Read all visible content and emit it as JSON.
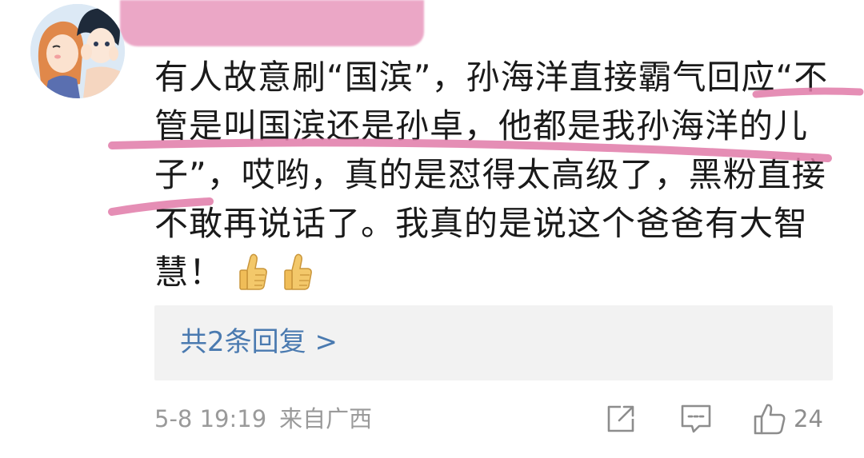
{
  "comment": {
    "lines": [
      "有人故意刷“国滨”，孙海洋直接霸气回应“不",
      "管是叫国滨还是孙卓，他都是我孙海洋的儿",
      "子”，哎哟，真的是怼得太高级了，黑粉直接",
      "不敢再说话了。我真的是说这个爸爸有大智",
      "慧！"
    ],
    "emoji": [
      "thumbs-up",
      "thumbs-up"
    ],
    "highlight_color": "#e07aa8"
  },
  "replies": {
    "label": "共2条回复 >"
  },
  "meta": {
    "date": "5-8 19:19",
    "location": "来自广西"
  },
  "actions": {
    "like_count": "24"
  },
  "colors": {
    "text": "#1a1a1a",
    "link": "#4a7ab0",
    "muted": "#9a9a9a",
    "reply_bg": "#f2f2f2"
  }
}
